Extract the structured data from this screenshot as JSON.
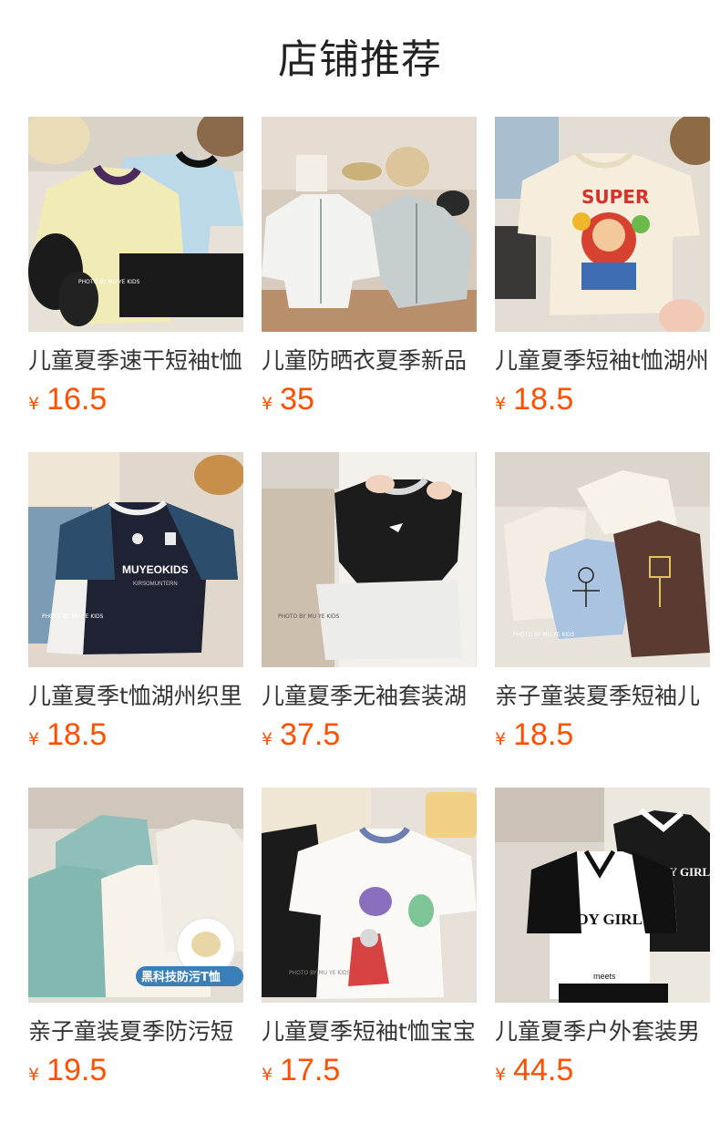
{
  "page": {
    "title": "店铺推荐"
  },
  "colors": {
    "price": "#ff5000",
    "text": "#333333"
  },
  "products": [
    {
      "name": "儿童夏季速干短袖t恤",
      "currency": "¥",
      "price": "16.5",
      "image": "yellow-blue-tshirts-photo"
    },
    {
      "name": "儿童防晒衣夏季新品",
      "currency": "¥",
      "price": "35",
      "image": "white-sun-jackets-photo"
    },
    {
      "name": "儿童夏季短袖t恤湖州",
      "currency": "¥",
      "price": "18.5",
      "image": "super-mario-tshirt-photo"
    },
    {
      "name": "儿童夏季t恤湖州织里",
      "currency": "¥",
      "price": "18.5",
      "image": "navy-jersey-tshirt-photo"
    },
    {
      "name": "儿童夏季无袖套装湖",
      "currency": "¥",
      "price": "37.5",
      "image": "black-vest-set-photo"
    },
    {
      "name": "亲子童装夏季短袖儿",
      "currency": "¥",
      "price": "18.5",
      "image": "doodle-family-tshirts-photo"
    },
    {
      "name": "亲子童装夏季防污短",
      "currency": "¥",
      "price": "19.5",
      "image": "mint-cream-tshirts-photo"
    },
    {
      "name": "儿童夏季短袖t恤宝宝",
      "currency": "¥",
      "price": "17.5",
      "image": "cartoon-print-tshirt-photo"
    },
    {
      "name": "儿童夏季户外套装男",
      "currency": "¥",
      "price": "44.5",
      "image": "boy-girl-polo-set-photo"
    }
  ],
  "photo_text": {
    "watermark": "PHOTO BY MU YE KIDS",
    "jersey_logo": "MUYEOKIDS",
    "jersey_sub": "KIRSOMUNTERN",
    "mario_word": "SUPER",
    "badge_text": "黑科技防污T恤",
    "polo_logo": "BOY GIRL",
    "polo_sub": "meets"
  }
}
